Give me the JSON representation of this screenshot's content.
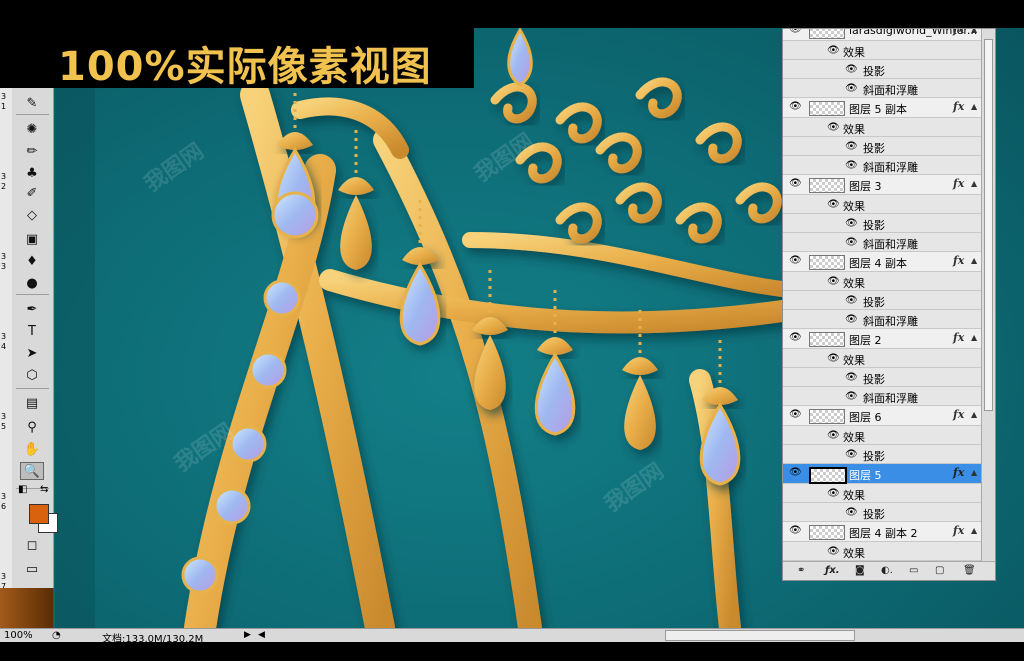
{
  "banner": {
    "title": "100%实际像素视图"
  },
  "colors": {
    "foreground": "#d9620e",
    "background": "#ffffff",
    "canvas": "#0d6a74",
    "gold": "#e8b24a",
    "accent_select": "#3a8ee6"
  },
  "ruler": {
    "labels": [
      "3",
      "1",
      "3",
      "2",
      "3",
      "3",
      "3",
      "4",
      "3",
      "5",
      "3",
      "6",
      "3",
      "7"
    ]
  },
  "tools": [
    {
      "name": "slice-tool-icon",
      "glyph": "✎"
    },
    {
      "name": "healing-brush-icon",
      "glyph": "✺"
    },
    {
      "name": "brush-tool-icon",
      "glyph": "✏"
    },
    {
      "name": "clone-stamp-icon",
      "glyph": "♣"
    },
    {
      "name": "history-brush-icon",
      "glyph": "✐"
    },
    {
      "name": "eraser-tool-icon",
      "glyph": "◇"
    },
    {
      "name": "gradient-tool-icon",
      "glyph": "▣"
    },
    {
      "name": "blur-tool-icon",
      "glyph": "♦"
    },
    {
      "name": "dodge-tool-icon",
      "glyph": "●"
    },
    {
      "name": "pen-tool-icon",
      "glyph": "✒"
    },
    {
      "name": "type-tool-icon",
      "glyph": "T"
    },
    {
      "name": "path-select-icon",
      "glyph": "➤"
    },
    {
      "name": "shape-tool-icon",
      "glyph": "⬡"
    },
    {
      "name": "notes-tool-icon",
      "glyph": "▤"
    },
    {
      "name": "eyedropper-icon",
      "glyph": "⚲"
    },
    {
      "name": "hand-tool-icon",
      "glyph": "✋"
    },
    {
      "name": "zoom-tool-icon",
      "glyph": "🔍"
    }
  ],
  "layers": {
    "effects_label": "效果",
    "drop_shadow": "投影",
    "bevel_emboss": "斜面和浮雕",
    "fx_label": "fx",
    "items": [
      {
        "name": "larasdigiworld_Winter...",
        "effects": [
          "投影",
          "斜面和浮雕"
        ],
        "selected": false
      },
      {
        "name": "图层 5 副本",
        "effects": [
          "投影",
          "斜面和浮雕"
        ],
        "selected": false
      },
      {
        "name": "图层 3",
        "effects": [
          "投影",
          "斜面和浮雕"
        ],
        "selected": false
      },
      {
        "name": "图层 4 副本",
        "effects": [
          "投影",
          "斜面和浮雕"
        ],
        "selected": false
      },
      {
        "name": "图层 2",
        "effects": [
          "投影",
          "斜面和浮雕"
        ],
        "selected": false
      },
      {
        "name": "图层 6",
        "effects": [
          "投影"
        ],
        "selected": false
      },
      {
        "name": "图层 5",
        "effects": [
          "投影"
        ],
        "selected": true
      },
      {
        "name": "图层 4 副本 2",
        "effects": [
          "效果"
        ],
        "selected": false
      }
    ]
  },
  "status": {
    "zoom": "100%",
    "doc": "文档:133.0M/130.2M"
  },
  "watermark": "我图网"
}
